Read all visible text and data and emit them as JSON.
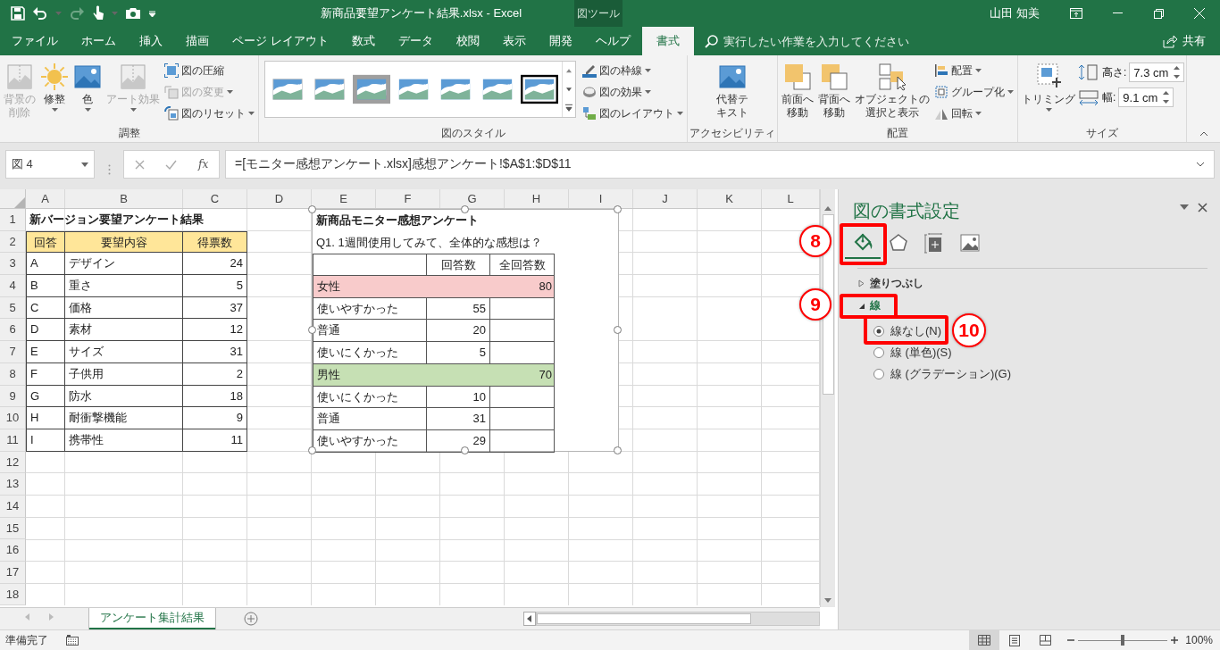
{
  "title_bar": {
    "title": "新商品要望アンケート結果.xlsx  -  Excel",
    "context_tab": "図ツール",
    "user": "山田 知美"
  },
  "menu_tabs": [
    {
      "label": "ファイル",
      "selected": false
    },
    {
      "label": "ホーム",
      "selected": false
    },
    {
      "label": "挿入",
      "selected": false
    },
    {
      "label": "描画",
      "selected": false
    },
    {
      "label": "ページ レイアウト",
      "selected": false
    },
    {
      "label": "数式",
      "selected": false
    },
    {
      "label": "データ",
      "selected": false
    },
    {
      "label": "校閲",
      "selected": false
    },
    {
      "label": "表示",
      "selected": false
    },
    {
      "label": "開発",
      "selected": false
    },
    {
      "label": "ヘルプ",
      "selected": false
    },
    {
      "label": "書式",
      "selected": true
    }
  ],
  "tell_me": {
    "placeholder": "実行したい作業を入力してください"
  },
  "share": "共有",
  "ribbon": {
    "adjust": {
      "label": "調整",
      "big": [
        {
          "label": "背景の削除",
          "disabled": true
        },
        {
          "label": "修整",
          "disabled": false
        },
        {
          "label": "色",
          "disabled": false
        },
        {
          "label": "アート効果",
          "disabled": true
        }
      ],
      "small": [
        {
          "label": "図の圧縮",
          "disabled": false
        },
        {
          "label": "図の変更",
          "disabled": true
        },
        {
          "label": "図のリセット",
          "disabled": false
        }
      ]
    },
    "styles": {
      "label": "図のスタイル",
      "small": [
        "図の枠線",
        "図の効果",
        "図のレイアウト"
      ]
    },
    "accessibility": {
      "label": "アクセシビリティ",
      "button": "代替テキスト"
    },
    "arrange": {
      "label": "配置",
      "big": [
        "前面へ移動",
        "背面へ移動",
        "オブジェクトの選択と表示"
      ],
      "small": [
        "配置",
        "グループ化",
        "回転"
      ]
    },
    "size": {
      "label": "サイズ",
      "crop": "トリミング",
      "height": {
        "label": "高さ:",
        "value": "7.3 cm"
      },
      "width": {
        "label": "幅:",
        "value": "9.1 cm"
      }
    }
  },
  "formula_bar": {
    "name_box": "図 4",
    "function_label": "fx",
    "formula": "=[モニター感想アンケート.xlsx]感想アンケート!$A$1:$D$11"
  },
  "sheet": {
    "columns": [
      "A",
      "B",
      "C",
      "D",
      "E",
      "F",
      "G",
      "H",
      "I",
      "J",
      "K",
      "L"
    ],
    "rows": [
      "1",
      "2",
      "3",
      "4",
      "5",
      "6",
      "7",
      "8",
      "9",
      "10",
      "11",
      "12",
      "13",
      "14",
      "15",
      "16",
      "17",
      "18"
    ],
    "title": "新バージョン要望アンケート結果",
    "header": [
      "回答",
      "要望内容",
      "得票数"
    ],
    "records": [
      [
        "A",
        "デザイン",
        "24"
      ],
      [
        "B",
        "重さ",
        "5"
      ],
      [
        "C",
        "価格",
        "37"
      ],
      [
        "D",
        "素材",
        "12"
      ],
      [
        "E",
        "サイズ",
        "31"
      ],
      [
        "F",
        "子供用",
        "2"
      ],
      [
        "G",
        "防水",
        "18"
      ],
      [
        "H",
        "耐衝撃機能",
        "9"
      ],
      [
        "I",
        "携帯性",
        "11"
      ]
    ]
  },
  "linked_picture": {
    "title": "新商品モニター感想アンケート",
    "question": "Q1. 1週間使用してみて、全体的な感想は？",
    "header": [
      "回答数",
      "全回答数"
    ],
    "rows": [
      {
        "kind": "group",
        "label": "女性",
        "total": "80",
        "color": "#f8cbcb"
      },
      {
        "kind": "item",
        "label": "使いやすかった",
        "count": "55"
      },
      {
        "kind": "item",
        "label": "普通",
        "count": "20"
      },
      {
        "kind": "item",
        "label": "使いにくかった",
        "count": "5"
      },
      {
        "kind": "group",
        "label": "男性",
        "total": "70",
        "color": "#c6e0b4"
      },
      {
        "kind": "item",
        "label": "使いにくかった",
        "count": "10"
      },
      {
        "kind": "item",
        "label": "普通",
        "count": "31"
      },
      {
        "kind": "item",
        "label": "使いやすかった",
        "count": "29"
      }
    ]
  },
  "panel": {
    "title": "図の書式設定",
    "tabs": [
      {
        "selected": true
      },
      {
        "selected": false
      },
      {
        "selected": false
      },
      {
        "selected": false
      }
    ],
    "sections": [
      {
        "label": "塗りつぶし",
        "expanded": false
      },
      {
        "label": "線",
        "expanded": true,
        "options": [
          {
            "label": "線なし(N)",
            "selected": true
          },
          {
            "label": "線 (単色)(S)",
            "selected": false
          },
          {
            "label": "線 (グラデーション)(G)",
            "selected": false
          }
        ]
      }
    ]
  },
  "annotations": [
    {
      "number": "8"
    },
    {
      "number": "9"
    },
    {
      "number": "10"
    }
  ],
  "sheet_tabs": [
    {
      "label": "アンケート集計結果",
      "selected": true
    }
  ],
  "status_bar": {
    "status": "準備完了",
    "zoom": "100%",
    "zoom_slider": {
      "level": 0.5
    }
  }
}
